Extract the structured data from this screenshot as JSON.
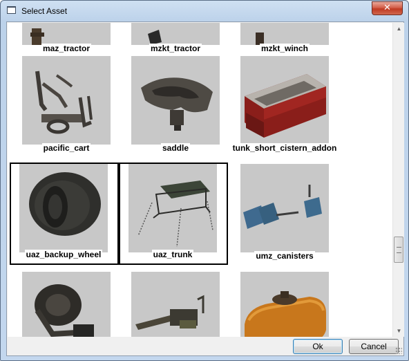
{
  "window": {
    "title": "Select Asset",
    "close_glyph": "✕"
  },
  "assets": [
    {
      "name": "maz_tractor",
      "icon": "tractor-model",
      "selected": false
    },
    {
      "name": "mzkt_tractor",
      "icon": "tractor-model",
      "selected": false
    },
    {
      "name": "mzkt_winch",
      "icon": "winch-model",
      "selected": false
    },
    {
      "name": "pacific_cart",
      "icon": "cart-model",
      "selected": false
    },
    {
      "name": "saddle",
      "icon": "saddle-model",
      "selected": false
    },
    {
      "name": "tunk_short_cistern_addon",
      "icon": "cistern-model",
      "selected": false
    },
    {
      "name": "uaz_backup_wheel",
      "icon": "wheel-model",
      "selected": true
    },
    {
      "name": "uaz_trunk",
      "icon": "roof-rack-model",
      "selected": true
    },
    {
      "name": "umz_canisters",
      "icon": "canisters-model",
      "selected": false
    },
    {
      "name": "",
      "icon": "tracked-wheel-model",
      "selected": false
    },
    {
      "name": "",
      "icon": "crane-model",
      "selected": false
    },
    {
      "name": "",
      "icon": "tank-model",
      "selected": false
    }
  ],
  "scrollbar": {
    "up_glyph": "▲",
    "down_glyph": "▼"
  },
  "buttons": {
    "ok_label": "Ok",
    "cancel_label": "Cancel"
  }
}
